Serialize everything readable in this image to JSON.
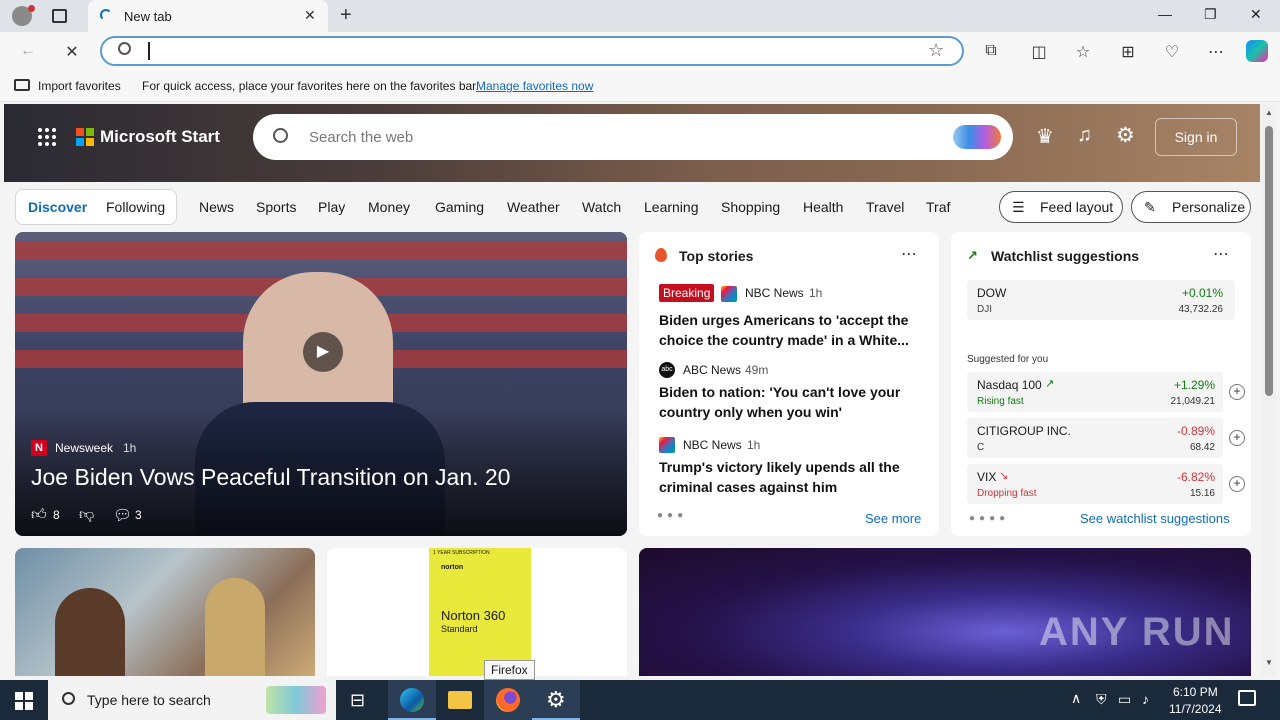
{
  "browser": {
    "tab_title": "New tab",
    "address_value": "",
    "favorites_import": "Import favorites",
    "favorites_hint": "For quick access, place your favorites here on the favorites bar.",
    "favorites_link": "Manage favorites now"
  },
  "header": {
    "brand": "Microsoft Start",
    "search_placeholder": "Search the web",
    "sign_in": "Sign in"
  },
  "nav": {
    "discover": "Discover",
    "following": "Following",
    "links": [
      "News",
      "Sports",
      "Play",
      "Money",
      "Gaming",
      "Weather",
      "Watch",
      "Learning",
      "Shopping",
      "Health",
      "Travel",
      "Traf"
    ],
    "feed_layout": "Feed layout",
    "personalize": "Personalize"
  },
  "hero": {
    "source": "Newsweek",
    "age": "1h",
    "title": "Joe Biden Vows Peaceful Transition on Jan. 20",
    "likes": "8",
    "comments": "3"
  },
  "top_stories": {
    "title": "Top stories",
    "items": [
      {
        "badge": "Breaking",
        "source": "NBC News",
        "age": "1h",
        "title": "Biden urges Americans to 'accept the choice the country made' in a White..."
      },
      {
        "source": "ABC News",
        "age": "49m",
        "title": "Biden to nation: 'You can't love your country only when you win'"
      },
      {
        "source": "NBC News",
        "age": "1h",
        "title": "Trump's victory likely upends all the criminal cases against him"
      }
    ],
    "see_more": "See more"
  },
  "watchlist": {
    "title": "Watchlist suggestions",
    "dow": {
      "name": "DOW",
      "ticker": "DJI",
      "change": "+0.01%",
      "value": "43,732.26"
    },
    "suggested_label": "Suggested for you",
    "items": [
      {
        "name": "Nasdaq 100",
        "sub": "Rising fast",
        "change": "+1.29%",
        "value": "21,049.21",
        "color": "#107c10"
      },
      {
        "name": "CITIGROUP INC.",
        "sub": "C",
        "change": "-0.89%",
        "value": "68.42",
        "color": "#d13438"
      },
      {
        "name": "VIX",
        "sub": "Dropping fast",
        "change": "-6.82%",
        "value": "15.16",
        "color": "#d13438"
      }
    ],
    "see_link": "See watchlist suggestions"
  },
  "promo": {
    "subscription": "1 YEAR SUBSCRIPTION",
    "brand": "norton",
    "product": "Norton 360",
    "edition": "Standard"
  },
  "watermark": "ANY RUN",
  "taskbar": {
    "search_placeholder": "Type here to search",
    "time": "6:10 PM",
    "date": "11/7/2024",
    "tooltip": "Firefox"
  },
  "colors": {
    "accent": "#0f6cbd",
    "positive": "#107c10",
    "negative": "#d13438",
    "breaking": "#c50f1f"
  }
}
